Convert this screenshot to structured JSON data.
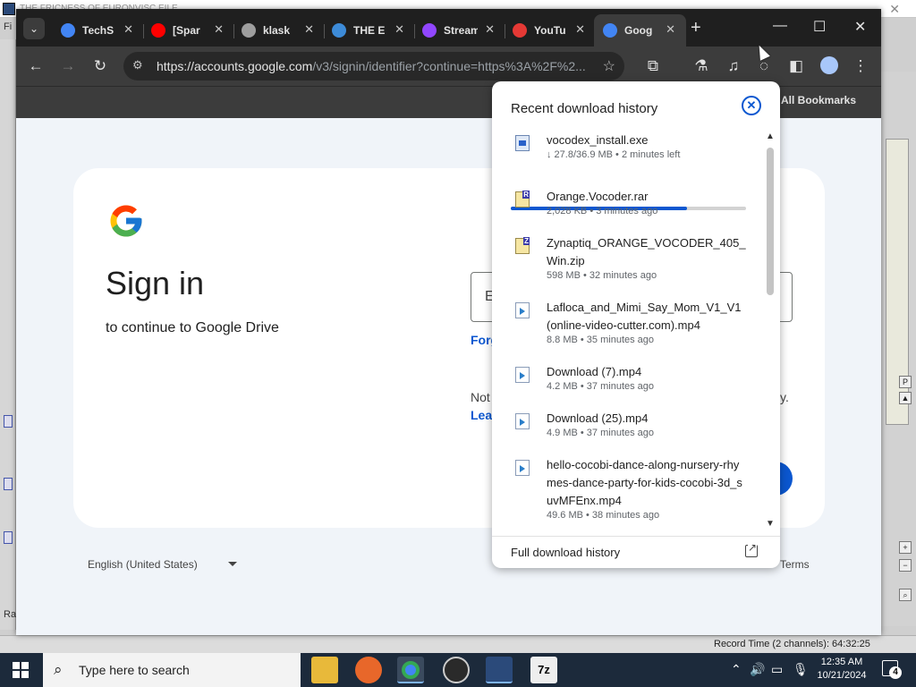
{
  "background_app": {
    "title": "THE FRICNESS OF EURONVISC EILE",
    "menu_initial": "Fi",
    "status_left": "Ra",
    "record_time": "Record Time (2 channels): 64:32:25"
  },
  "browser": {
    "tabs": [
      {
        "label": "TechS",
        "favicon_color": "#4285f4",
        "active": false
      },
      {
        "label": "[Spar",
        "favicon_color": "#ff0000",
        "active": false
      },
      {
        "label": "klask",
        "favicon_color": "#9e9e9e",
        "active": false
      },
      {
        "label": "THE E",
        "favicon_color": "#3d8bd8",
        "active": false
      },
      {
        "label": "Stream",
        "favicon_color": "#9146ff",
        "active": false
      },
      {
        "label": "YouTu",
        "favicon_color": "#e53935",
        "active": false
      },
      {
        "label": "Goog",
        "favicon_color": "#4285f4",
        "active": true
      }
    ],
    "url_host": "https://accounts.google.com",
    "url_path": "/v3/signin/identifier?continue=https%3A%2F%2...",
    "all_bookmarks": "All Bookmarks"
  },
  "signin": {
    "title": "Sign in",
    "subtitle": "to continue to Google Drive",
    "email_placeholder": "E",
    "forgot": "Forg",
    "not_computer": "Not",
    "not_computer_end": "y.",
    "learn": "Lea",
    "language": "English (United States)",
    "terms": "Terms"
  },
  "downloads": {
    "title": "Recent download history",
    "items": [
      {
        "name": "vocodex_install.exe",
        "meta": "↓ 27.8/36.9 MB • 2 minutes left",
        "type": "exe",
        "progress": 0.75
      },
      {
        "name": "Orange.Vocoder.rar",
        "meta": "2,028 KB • 3 minutes ago",
        "type": "rar"
      },
      {
        "name": "Zynaptiq_ORANGE_VOCODER_405_Win.zip",
        "meta": "598 MB • 32 minutes ago",
        "type": "zip"
      },
      {
        "name": "Lafloca_and_Mimi_Say_Mom_V1_V1 (online-video-cutter.com).mp4",
        "meta": "8.8 MB • 35 minutes ago",
        "type": "mp4"
      },
      {
        "name": "Download (7).mp4",
        "meta": "4.2 MB • 37 minutes ago",
        "type": "mp4"
      },
      {
        "name": "Download (25).mp4",
        "meta": "4.9 MB • 37 minutes ago",
        "type": "mp4"
      },
      {
        "name": "hello-cocobi-dance-along-nursery-rhymes-dance-party-for-kids-cocobi-3d_suvMFEnx.mp4",
        "meta": "49.6 MB • 38 minutes ago",
        "type": "mp4"
      }
    ],
    "footer": "Full download history"
  },
  "taskbar": {
    "search_placeholder": "Type here to search",
    "time": "12:35 AM",
    "date": "10/21/2024",
    "notification_count": "4"
  }
}
